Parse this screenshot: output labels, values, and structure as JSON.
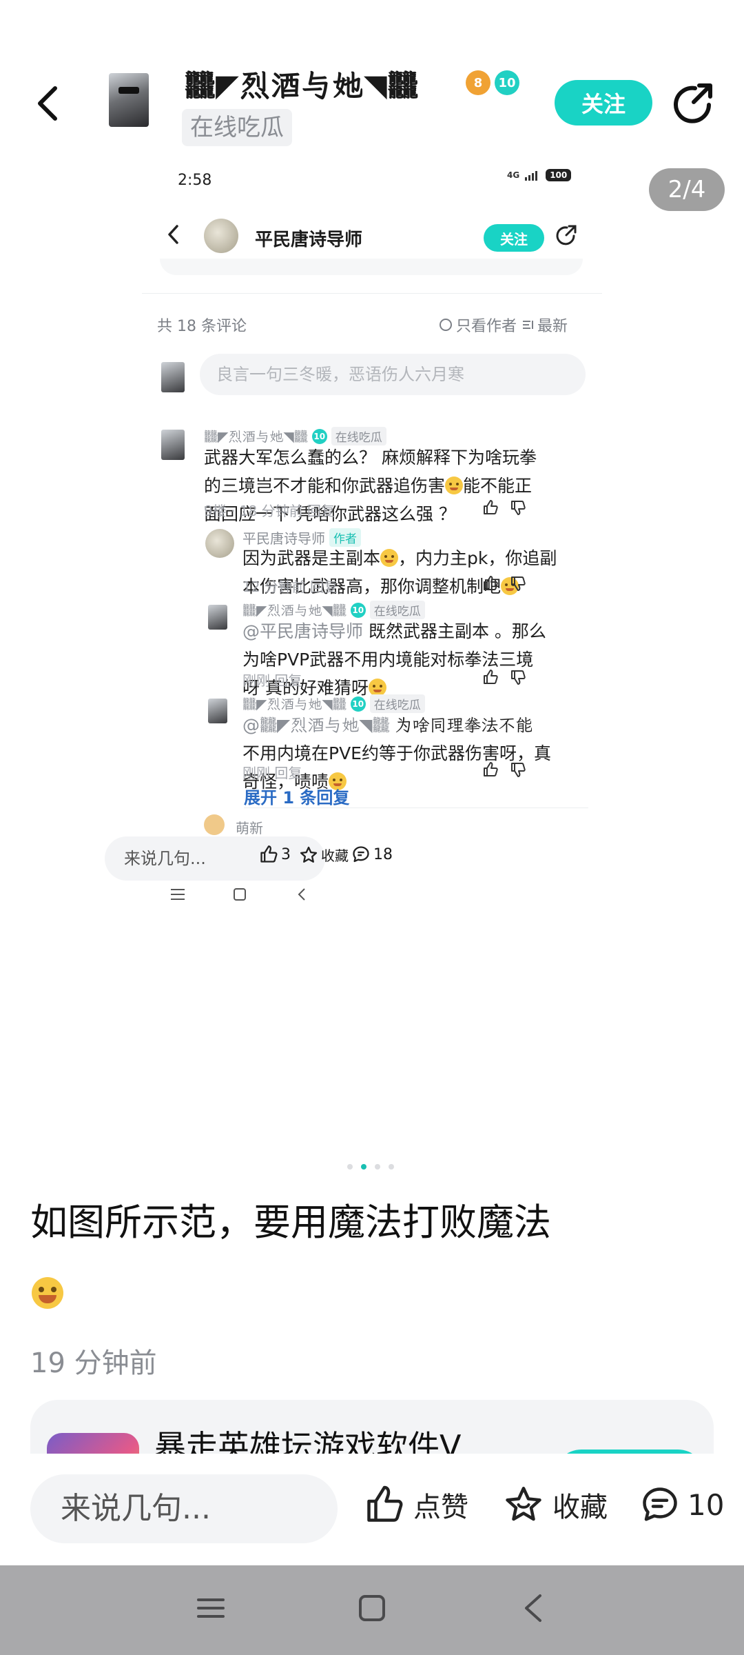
{
  "header": {
    "user_name": "𪚥◤烈酒与她◥𪚥",
    "badge_gold": "8",
    "badge_level": "10",
    "user_tag": "在线吃瓜",
    "follow_label": "关注"
  },
  "image": {
    "page_indicator": "2/4",
    "dots": 4,
    "active_dot": 1
  },
  "screenshot": {
    "time": "2:58",
    "signal": "4G",
    "battery": "100",
    "nav_name": "平民唐诗导师",
    "nav_follow": "关注",
    "comment_count": "共 18 条评论",
    "only_author": "只看作者",
    "latest": "最新",
    "input_placeholder": "良言一句三冬暖，恶语伤人六月寒",
    "comments": [
      {
        "name": "𪚥◤烈酒与她◥𪚥",
        "level": "10",
        "tag": "在线吃瓜",
        "text1": "武器大军怎么蠢的么？ 麻烦解释下为啥玩拳",
        "text2": "的三境岂不才能和你武器追伤害",
        "text2b": "能不能正",
        "text3": "面回应一下  凭啥你武器这么强 ？",
        "meta": "9楼 · 18 分钟前  回复"
      },
      {
        "name": "平民唐诗导师",
        "author_tag": "作者",
        "text1a": "因为武器是主副本",
        "text1b": "，内力主pk，你追副",
        "text2": "本伤害比武器高，那你调整机制吧",
        "meta": "12 分钟前  回复"
      },
      {
        "name": "𪚥◤烈酒与她◥𪚥",
        "level": "10",
        "tag": "在线吃瓜",
        "mention": "@平民唐诗导师",
        "text1": "  既然武器主副本 。那么",
        "text2": "为啥PVP武器不用内境能对标拳法三境",
        "text3": "呀  真的好难猜呀",
        "meta": "刚刚  回复"
      },
      {
        "name": "𪚥◤烈酒与她◥𪚥",
        "level": "10",
        "tag": "在线吃瓜",
        "mention": "@𪚥◤烈酒与她◥𪚥",
        "text1": "  为啥同理拳法不能",
        "text2": "不用内境在PVE约等于你武器伤害呀，真",
        "text3": "奇怪，啧啧",
        "meta": "刚刚  回复"
      }
    ],
    "expand": "展开 1 条回复",
    "next_name": "萌新",
    "bottom_input": "来说几句...",
    "likes": "3",
    "fav": "收藏",
    "comments_count": "18"
  },
  "post": {
    "text": "如图所示范，要用魔法打败魔法",
    "time": "19 分钟前"
  },
  "game_card": {
    "title": "暴走英雄坛游戏软件V..."
  },
  "bottom_bar": {
    "input_placeholder": "来说几句...",
    "like_label": "点赞",
    "fav_label": "收藏",
    "comment_count": "10"
  },
  "colors": {
    "accent": "#19d3c5",
    "link": "#2a6bc4",
    "nav_bar": "#a9a9ab"
  }
}
